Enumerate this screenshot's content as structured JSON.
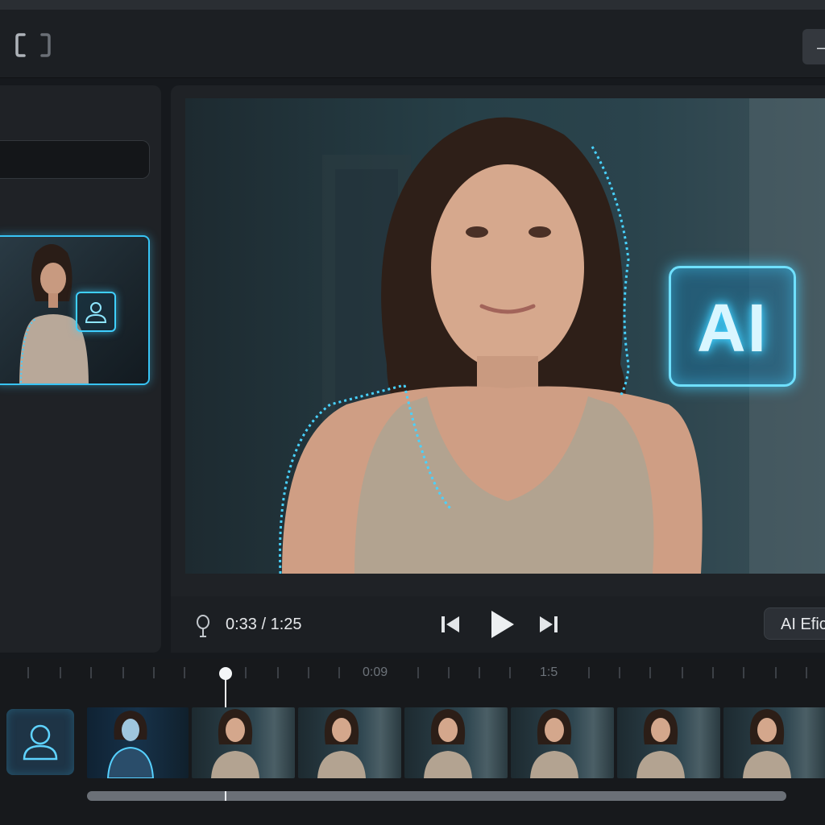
{
  "player": {
    "time_current": "0:33",
    "time_separator": " / ",
    "time_total": "1:25",
    "time_display": "0:33 / 1:25",
    "ai_badge_text": "AI",
    "effects_button_label": "AI Efic"
  },
  "timeline": {
    "tick_labels": [
      "0:09",
      "1:5"
    ],
    "frame_count": 7
  },
  "colors": {
    "accent_glow": "#38c4f5",
    "background": "#16191d",
    "panel": "#1f2226"
  },
  "icons": {
    "header_logo": "bracket-frame-icon",
    "header_button": "minus-icon",
    "pin": "location-pin-icon",
    "prev": "skip-previous-icon",
    "play": "play-icon",
    "next": "skip-next-icon",
    "track": "person-silhouette-icon",
    "thumb_ai": "person-outline-icon"
  }
}
